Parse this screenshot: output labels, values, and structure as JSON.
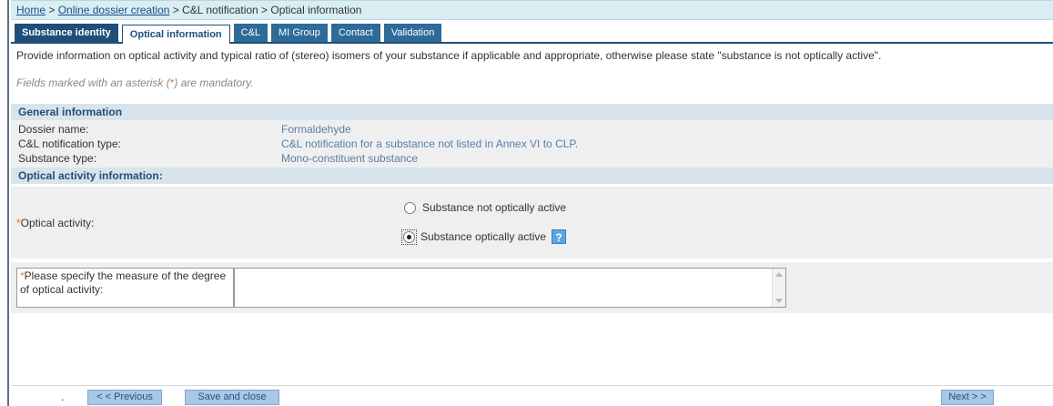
{
  "breadcrumb": {
    "home": "Home",
    "sep1": " > ",
    "online": "Online dossier creation",
    "rest": " > C&L notification > Optical information"
  },
  "tabs": [
    {
      "label": "Substance identity"
    },
    {
      "label": "Optical information"
    },
    {
      "label": "C&L"
    },
    {
      "label": "MI Group"
    },
    {
      "label": "Contact"
    },
    {
      "label": "Validation"
    }
  ],
  "intro": "Provide information on optical activity and typical ratio of (stereo) isomers of your substance if applicable and appropriate, otherwise please state \"substance is not optically active\".",
  "mandatory": {
    "prefix": "Fields marked with an asterisk (",
    "asterisk": "*",
    "suffix": ") are mandatory."
  },
  "general": {
    "title": "General information",
    "rows": [
      {
        "label": "Dossier name:",
        "value": "Formaldehyde"
      },
      {
        "label": "C&L notification type:",
        "value": "C&L notification for a substance not listed in Annex VI to CLP."
      },
      {
        "label": "Substance type:",
        "value": "Mono-constituent substance"
      }
    ]
  },
  "optical": {
    "title": "Optical activity information:",
    "activity_label": "Optical activity:",
    "option_not_active": "Substance not optically active",
    "option_active": "Substance optically active",
    "selected": "Substance optically active",
    "help": "?",
    "measure_label": "Please specify the measure of the degree of optical activity:",
    "measure_value": ""
  },
  "footer": {
    "dot": ".",
    "previous": "< < Previous",
    "save_close": "Save and close",
    "next": "Next > >"
  },
  "colors": {
    "tab_bg": "#2f6b98",
    "section_bg": "#d8e4ec",
    "value_text": "#5a7ea6",
    "asterisk": "#e07a2f",
    "button_bg": "#a9c7e6"
  }
}
